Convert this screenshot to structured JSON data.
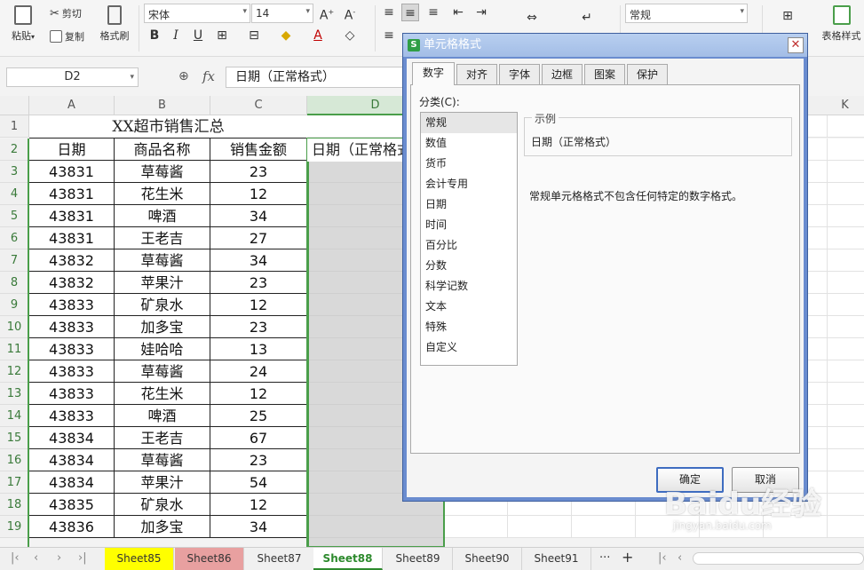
{
  "ribbon": {
    "paste": "粘贴",
    "cut": "剪切",
    "copy": "复制",
    "format_painter": "格式刷",
    "font_name": "宋体",
    "font_size": "14",
    "number_format": "常规",
    "table_style": "表格样式"
  },
  "formula_bar": {
    "name_box": "D2",
    "fx": "fx",
    "content": "日期（正常格式）"
  },
  "sheet": {
    "columns": [
      "A",
      "B",
      "C",
      "D",
      "K"
    ],
    "rows": [
      "1",
      "2",
      "3",
      "4",
      "5",
      "6",
      "7",
      "8",
      "9",
      "10",
      "11",
      "12",
      "13",
      "14",
      "15",
      "16",
      "17",
      "18",
      "19"
    ],
    "title": "XX超市销售汇总",
    "headers": [
      "日期",
      "商品名称",
      "销售金额"
    ],
    "d2": "日期（正常格式）",
    "data": [
      [
        "43831",
        "草莓酱",
        "23"
      ],
      [
        "43831",
        "花生米",
        "12"
      ],
      [
        "43831",
        "啤酒",
        "34"
      ],
      [
        "43831",
        "王老吉",
        "27"
      ],
      [
        "43832",
        "草莓酱",
        "34"
      ],
      [
        "43832",
        "苹果汁",
        "23"
      ],
      [
        "43833",
        "矿泉水",
        "12"
      ],
      [
        "43833",
        "加多宝",
        "23"
      ],
      [
        "43833",
        "娃哈哈",
        "13"
      ],
      [
        "43833",
        "草莓酱",
        "24"
      ],
      [
        "43833",
        "花生米",
        "12"
      ],
      [
        "43833",
        "啤酒",
        "25"
      ],
      [
        "43834",
        "王老吉",
        "67"
      ],
      [
        "43834",
        "草莓酱",
        "23"
      ],
      [
        "43834",
        "苹果汁",
        "54"
      ],
      [
        "43835",
        "矿泉水",
        "12"
      ],
      [
        "43836",
        "加多宝",
        "34"
      ]
    ]
  },
  "tabs": [
    {
      "label": "Sheet85",
      "color": "#ffff00"
    },
    {
      "label": "Sheet86",
      "color": "#e8a0a0"
    },
    {
      "label": "Sheet87",
      "color": ""
    },
    {
      "label": "Sheet88",
      "color": ""
    },
    {
      "label": "Sheet89",
      "color": ""
    },
    {
      "label": "Sheet90",
      "color": ""
    },
    {
      "label": "Sheet91",
      "color": ""
    }
  ],
  "tabs_more": "···",
  "tabs_add": "+",
  "dialog": {
    "title": "单元格格式",
    "close": "✕",
    "tabs": [
      "数字",
      "对齐",
      "字体",
      "边框",
      "图案",
      "保护"
    ],
    "category_label": "分类(C):",
    "categories": [
      "常规",
      "数值",
      "货币",
      "会计专用",
      "日期",
      "时间",
      "百分比",
      "分数",
      "科学记数",
      "文本",
      "特殊",
      "自定义"
    ],
    "example_title": "示例",
    "example_value": "日期（正常格式）",
    "description": "常规单元格格式不包含任何特定的数字格式。",
    "ok": "确定",
    "cancel": "取消"
  },
  "watermark": "Baidu经验",
  "watermark_url": "jingyan.baidu.com"
}
